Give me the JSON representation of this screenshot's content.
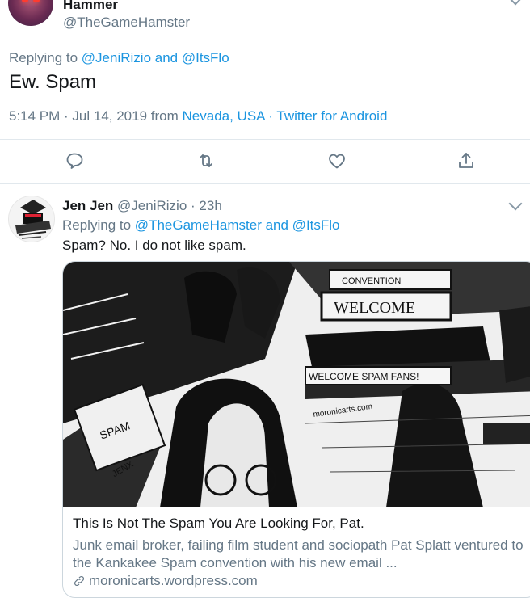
{
  "tweet1": {
    "name": "Hammer",
    "handle": "@TheGameHamster",
    "replying_prefix": "Replying to",
    "replying_users": "@JeniRizio and @ItsFlo",
    "body": "Ew. Spam",
    "time": "5:14 PM · Jul 14, 2019 from",
    "location": "Nevada, USA",
    "separator": "·",
    "source": "Twitter for Android"
  },
  "actions": [
    {
      "icon": "reply-icon"
    },
    {
      "icon": "retweet-icon"
    },
    {
      "icon": "like-icon"
    },
    {
      "icon": "share-icon"
    }
  ],
  "tweet2": {
    "name": "Jen Jen",
    "handle": "@JeniRizio",
    "dot": "·",
    "age": "23h",
    "replying_prefix": "Replying to",
    "replying_users": "@TheGameHamster and @ItsFlo",
    "body": "Spam? No. I do not like spam."
  },
  "card": {
    "image_texts": {
      "convention": "CONVENTION",
      "welcome_banner": "WELCOME",
      "welcome_spam": "WELCOME SPAM FANS!",
      "site": "moronicarts.com",
      "spam": "SPAM",
      "artist": "JENX"
    },
    "title": "This Is Not The Spam You Are Looking For, Pat.",
    "description": "Junk email broker, failing film student and sociopath Pat Splatt ventured to the Kankakee Spam convention with his new email ...",
    "url": "moronicarts.wordpress.com"
  },
  "colors": {
    "link": "#1b95e0",
    "muted": "#657786",
    "text": "#14171a",
    "divider": "#e1e8ed"
  }
}
